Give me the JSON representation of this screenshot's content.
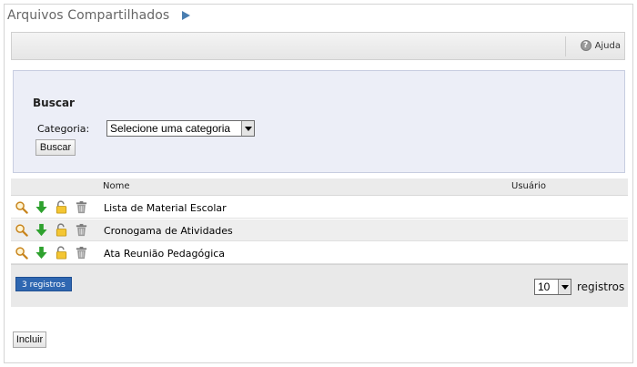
{
  "page": {
    "title": "Arquivos Compartilhados"
  },
  "toolbar": {
    "help_label": "Ajuda",
    "help_icon": "help-icon"
  },
  "search": {
    "title": "Buscar",
    "category_label": "Categoria:",
    "category_value": "Selecione uma categoria",
    "button_label": "Buscar"
  },
  "table": {
    "columns": [
      "Nome",
      "Usuário"
    ],
    "rows": [
      {
        "nome": "Lista de Material Escolar",
        "usuario": ""
      },
      {
        "nome": "Cronogama de Atividades",
        "usuario": ""
      },
      {
        "nome": "Ata Reunião Pedagógica",
        "usuario": ""
      }
    ],
    "row_actions": [
      "view-icon",
      "download-icon",
      "unlock-icon",
      "trash-icon"
    ]
  },
  "footer": {
    "count_label": "3 registros",
    "per_page_value": "10",
    "per_page_label": "registros"
  },
  "actions": {
    "include_label": "Incluir"
  },
  "colors": {
    "title_arrow": "#4a7eb0",
    "badge": "#2f67b1",
    "download_arrow": "#2ea12e",
    "lock": "#e0b21e"
  }
}
